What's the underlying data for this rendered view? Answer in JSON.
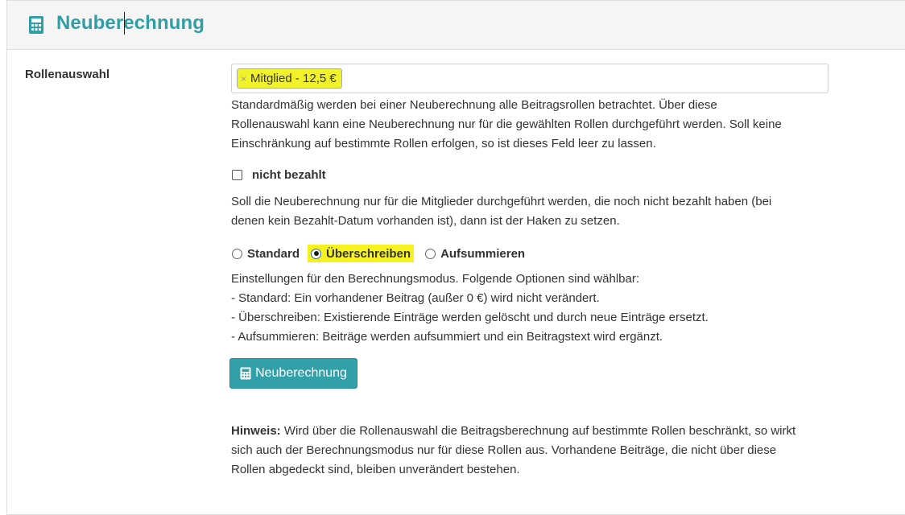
{
  "header": {
    "title": "Neuberechnung",
    "icon": "calculator-icon",
    "title_color": "#2f9ea5"
  },
  "roles": {
    "label": "Rollenauswahl",
    "selected_tags": [
      {
        "remove": "×",
        "text": "Mitglied - 12,5 €"
      }
    ],
    "help_lines": [
      "Standardmäßig werden bei einer Neuberechnung alle Beitragsrollen betrachtet. Über diese",
      "Rollenauswahl kann eine Neuberechnung nur für die gewählten Rollen durchgeführt werden. Soll keine",
      "Einschränkung auf bestimmte Rollen erfolgen, so ist dieses Feld leer zu lassen."
    ]
  },
  "unpaid": {
    "label": "nicht bezahlt",
    "checked": false,
    "help_lines": [
      "Soll die Neuberechnung nur für die Mitglieder durchgeführt werden, die noch nicht bezahlt haben (bei",
      "denen kein Bezahlt-Datum vorhanden ist), dann ist der Haken zu setzen."
    ]
  },
  "mode": {
    "options": [
      "Standard",
      "Überschreiben",
      "Aufsummieren"
    ],
    "selected": "Überschreiben",
    "help_lines": [
      "Einstellungen für den Berechnungsmodus. Folgende Optionen sind wählbar:",
      "- Standard: Ein vorhandener Beitrag (außer 0 €) wird nicht verändert.",
      "- Überschreiben: Existierende Einträge werden gelöscht und durch neue Einträge ersetzt.",
      "- Aufsummieren: Beiträge werden aufsummiert und ein Beitragstext wird ergänzt."
    ]
  },
  "submit": {
    "label": "Neuberechnung",
    "icon": "calculator-icon",
    "color": "#32a0a8"
  },
  "hint": {
    "label": "Hinweis:",
    "lines": [
      " Wird über die Rollenauswahl die Beitragsberechnung auf bestimmte Rollen beschränkt, so wirkt",
      "sich auch der Berechnungsmodus nur für diese Rollen aus. Vorhandene Beiträge, die nicht über diese",
      "Rollen abgedeckt sind, bleiben unverändert bestehen."
    ]
  },
  "highlight_color": "#f6f21f"
}
